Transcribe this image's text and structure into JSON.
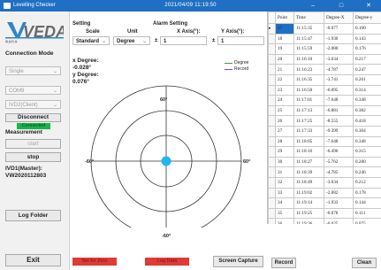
{
  "window": {
    "app_title": "Levelling Checker",
    "clock": "2021/04/09 11:19:50",
    "controls": [
      "–",
      "□",
      "✕"
    ]
  },
  "sidebar": {
    "logo_text": "VEDA",
    "logo_subtitle": "唯迪科技",
    "connection_mode_label": "Connection Mode",
    "connection_mode_value": "Single",
    "port_value": "COM9",
    "device_value": "IVD2(Client)",
    "disconnect_label": "Disconnect",
    "status_text": "Connected",
    "measurement_label": "Measurement",
    "start_label": "start",
    "stop_label": "stop",
    "device_info": "IVD1(Master):\nVW2020112803",
    "log_folder_label": "Log Folder",
    "exit_label": "Exit"
  },
  "settings": {
    "setting_label": "Setting",
    "scale_label": "Scale",
    "unit_label": "Unit",
    "scale_value": "Standard",
    "unit_value": "Degree",
    "alarm_label": "Alarm Setting",
    "x_axis_label": "X Axis(°):",
    "y_axis_label": "Y Axis(°):",
    "pm": "±",
    "x_axis_value": "1",
    "y_axis_value": "1"
  },
  "plot": {
    "x_label": "x Degree:",
    "x_value": "-0.028°",
    "y_label": "y Degree:",
    "y_value": "0.076°",
    "legend": [
      {
        "name": "Degree",
        "color": "#2ca24a"
      },
      {
        "name": "Record",
        "color": "#8b3fc0"
      }
    ],
    "tick_top": "60°",
    "tick_bottom": "-60°",
    "tick_left": "-60°",
    "tick_right": "60°",
    "dot_color": "#1fb6f0"
  },
  "actions": {
    "set_zero_label": "Set for Zero",
    "log_data_label": "Log Data",
    "screen_capture_label": "Screen Capture",
    "record_label": "Record",
    "clean_label": "Clean"
  },
  "table": {
    "columns": [
      "Point",
      "Time",
      "Degree-X",
      "Degree-y"
    ],
    "rows": [
      [
        "17",
        "11:15:35",
        "-0.077",
        "0.100"
      ],
      [
        "18",
        "11:15:47",
        "-1.930",
        "0.143"
      ],
      [
        "19",
        "11:15:59",
        "-2.080",
        "0.176"
      ],
      [
        "20",
        "11:16:10",
        "-3.034",
        "0.217"
      ],
      [
        "21",
        "11:16:23",
        "-4.787",
        "0.247"
      ],
      [
        "22",
        "11:16:35",
        "-3.741",
        "0.261"
      ],
      [
        "23",
        "11:16:50",
        "-6.095",
        "0.314"
      ],
      [
        "24",
        "11:17:01",
        "-7.648",
        "0.348"
      ],
      [
        "25",
        "11:17:13",
        "-6.881",
        "0.382"
      ],
      [
        "26",
        "11:17:25",
        "-8.555",
        "0.418"
      ],
      [
        "27",
        "11:17:33",
        "-9.399",
        "0.304"
      ],
      [
        "28",
        "11:18:05",
        "-7.648",
        "0.348"
      ],
      [
        "29",
        "11:18:16",
        "-6.496",
        "0.315"
      ],
      [
        "30",
        "11:18:27",
        "-5.762",
        "0.280"
      ],
      [
        "31",
        "11:18:39",
        "-4.785",
        "0.246"
      ],
      [
        "32",
        "11:18:49",
        "-3.034",
        "0.212"
      ],
      [
        "33",
        "11:19:02",
        "-2.082",
        "0.178"
      ],
      [
        "34",
        "11:19:14",
        "-1.933",
        "0.144"
      ],
      [
        "35",
        "11:19:25",
        "-0.078",
        "0.111"
      ],
      [
        "36",
        "11:19:36",
        "-0.025",
        "0.075"
      ]
    ]
  }
}
